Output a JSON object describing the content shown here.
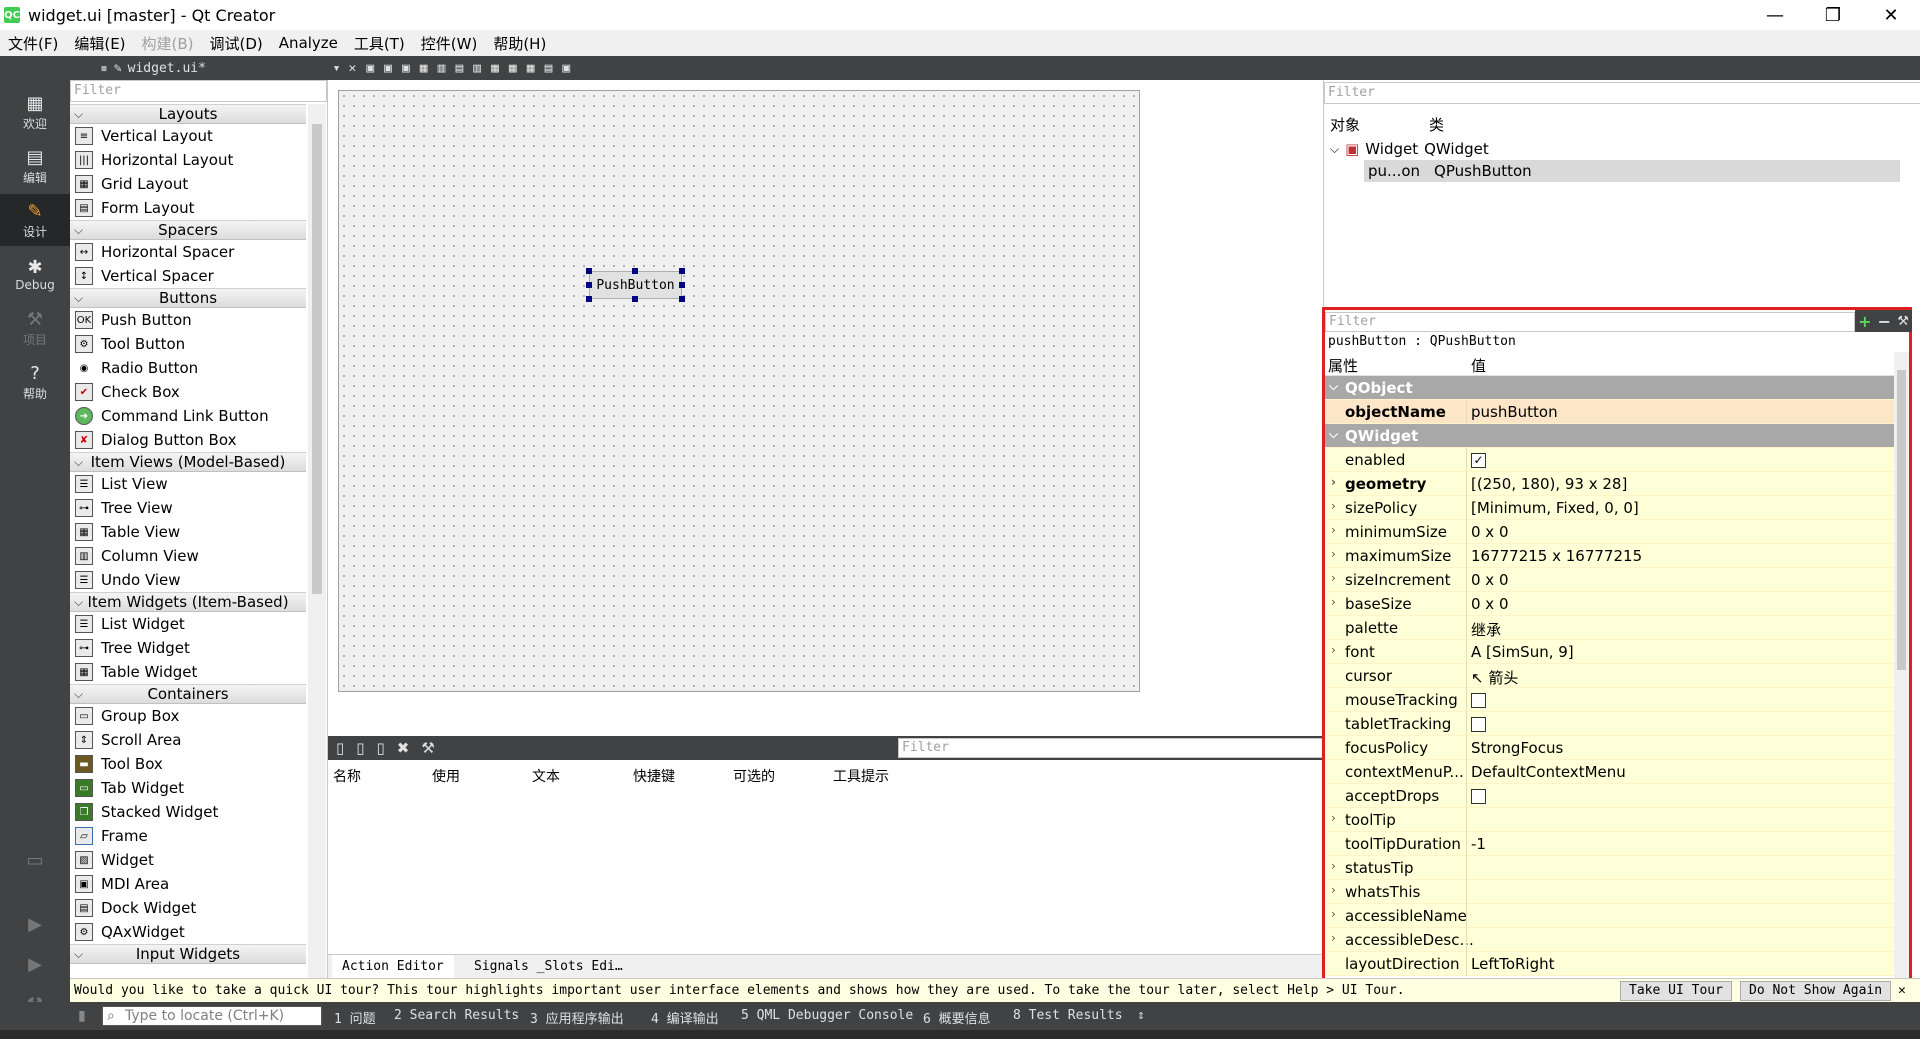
{
  "window": {
    "title": "widget.ui [master] - Qt Creator",
    "app_icon": "QC",
    "minimize": "—",
    "maximize": "❐",
    "close": "✕"
  },
  "menu": [
    "文件(F)",
    "编辑(E)",
    "构建(B)",
    "调试(D)",
    "Analyze",
    "工具(T)",
    "控件(W)",
    "帮助(H)"
  ],
  "modes": [
    {
      "label": "欢迎",
      "icon": "grid-icon"
    },
    {
      "label": "编辑",
      "icon": "edit-doc-icon"
    },
    {
      "label": "设计",
      "icon": "pencil-icon"
    },
    {
      "label": "Debug",
      "icon": "bug-icon"
    },
    {
      "label": "项目",
      "icon": "wrench-icon"
    },
    {
      "label": "帮助",
      "icon": "help-icon"
    }
  ],
  "editor_tab": {
    "file": "widget.ui*"
  },
  "widget_box": {
    "filter_placeholder": "Filter",
    "categories": {
      "layouts": "Layouts",
      "spacers": "Spacers",
      "buttons": "Buttons",
      "item_views": "Item Views (Model-Based)",
      "item_widgets": "Item Widgets (Item-Based)",
      "containers": "Containers",
      "input_widgets": "Input Widgets"
    },
    "items": {
      "vertical_layout": "Vertical Layout",
      "horizontal_layout": "Horizontal Layout",
      "grid_layout": "Grid Layout",
      "form_layout": "Form Layout",
      "horizontal_spacer": "Horizontal Spacer",
      "vertical_spacer": "Vertical Spacer",
      "push_button": "Push Button",
      "tool_button": "Tool Button",
      "radio_button": "Radio Button",
      "check_box": "Check Box",
      "command_link_button": "Command Link Button",
      "dialog_button_box": "Dialog Button Box",
      "list_view": "List View",
      "tree_view": "Tree View",
      "table_view": "Table View",
      "column_view": "Column View",
      "undo_view": "Undo View",
      "list_widget": "List Widget",
      "tree_widget": "Tree Widget",
      "table_widget": "Table Widget",
      "group_box": "Group Box",
      "scroll_area": "Scroll Area",
      "tool_box": "Tool Box",
      "tab_widget": "Tab Widget",
      "stacked_widget": "Stacked Widget",
      "frame": "Frame",
      "widget": "Widget",
      "mdi_area": "MDI Area",
      "dock_widget": "Dock Widget",
      "qax_widget": "QAxWidget"
    }
  },
  "form": {
    "push_button_text": "PushButton"
  },
  "action_editor": {
    "filter_placeholder": "Filter",
    "columns": [
      "名称",
      "使用",
      "文本",
      "快捷键",
      "可选的",
      "工具提示"
    ],
    "tabs": [
      "Action Editor",
      "Signals _Slots Edi…"
    ]
  },
  "object_inspector": {
    "filter_placeholder": "Filter",
    "col_object": "对象",
    "col_class": "类",
    "rows": [
      {
        "object": "Widget",
        "class": "QWidget"
      },
      {
        "object": "pu...on",
        "class": "QPushButton"
      }
    ]
  },
  "property_editor": {
    "filter_placeholder": "Filter",
    "object_label": "pushButton : QPushButton",
    "col_property": "属性",
    "col_value": "值",
    "group_qobject": "QObject",
    "group_qwidget": "QWidget",
    "rows": {
      "objectName": {
        "name": "objectName",
        "value": "pushButton"
      },
      "enabled": {
        "name": "enabled",
        "value": "✓"
      },
      "geometry": {
        "name": "geometry",
        "value": "[(250, 180), 93 x 28]"
      },
      "sizePolicy": {
        "name": "sizePolicy",
        "value": "[Minimum, Fixed, 0, 0]"
      },
      "minimumSize": {
        "name": "minimumSize",
        "value": "0 x 0"
      },
      "maximumSize": {
        "name": "maximumSize",
        "value": "16777215 x 16777215"
      },
      "sizeIncrement": {
        "name": "sizeIncrement",
        "value": "0 x 0"
      },
      "baseSize": {
        "name": "baseSize",
        "value": "0 x 0"
      },
      "palette": {
        "name": "palette",
        "value": "继承"
      },
      "font": {
        "name": "font",
        "value": "[SimSun, 9]"
      },
      "cursor": {
        "name": "cursor",
        "value": "箭头"
      },
      "mouseTracking": {
        "name": "mouseTracking",
        "value": ""
      },
      "tabletTracking": {
        "name": "tabletTracking",
        "value": ""
      },
      "focusPolicy": {
        "name": "focusPolicy",
        "value": "StrongFocus"
      },
      "contextMenuPolicy": {
        "name": "contextMenuP...",
        "value": "DefaultContextMenu"
      },
      "acceptDrops": {
        "name": "acceptDrops",
        "value": ""
      },
      "toolTip": {
        "name": "toolTip",
        "value": ""
      },
      "toolTipDuration": {
        "name": "toolTipDuration",
        "value": "-1"
      },
      "statusTip": {
        "name": "statusTip",
        "value": ""
      },
      "whatsThis": {
        "name": "whatsThis",
        "value": ""
      },
      "accessibleName": {
        "name": "accessibleName",
        "value": ""
      },
      "accessibleDescription": {
        "name": "accessibleDesc...",
        "value": ""
      },
      "layoutDirection": {
        "name": "layoutDirection",
        "value": "LeftToRight"
      }
    }
  },
  "tour": {
    "message": "Would you like to take a quick UI tour? This tour highlights important user interface elements and shows how they are used. To take the tour later, select Help > UI Tour.",
    "take_button": "Take UI Tour",
    "dismiss_button": "Do Not Show Again",
    "close": "✕"
  },
  "status_bar": {
    "locate_placeholder": "Type to locate (Ctrl+K)",
    "outputs": [
      "1 问题",
      "2 Search Results",
      "3 应用程序输出",
      "4 编译输出",
      "5 QML Debugger Console",
      "6 概要信息",
      "8 Test Results"
    ],
    "more": "⇕"
  },
  "colors": {
    "dark_panel": "#404244",
    "highlight_border": "#e0201e",
    "property_row_bg": "#ffffd8",
    "group_bg": "#a8a8a8"
  }
}
